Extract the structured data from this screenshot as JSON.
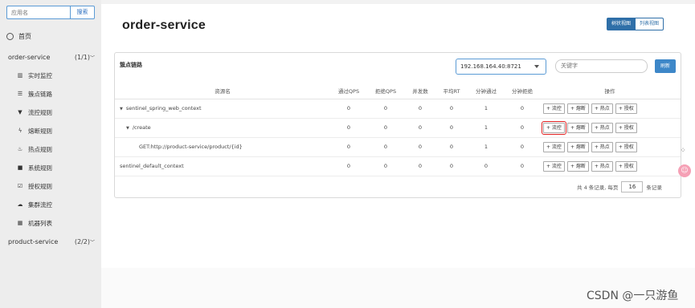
{
  "sidebar": {
    "search_placeholder": "应用名",
    "search_button": "搜索",
    "home": "首页",
    "apps": [
      {
        "name": "order-service",
        "count": "(1/1)",
        "items": [
          "实时监控",
          "簇点链路",
          "流控规则",
          "熔断规则",
          "热点规则",
          "系统规则",
          "授权规则",
          "集群流控",
          "机器列表"
        ]
      },
      {
        "name": "product-service",
        "count": "(2/2)"
      }
    ]
  },
  "main": {
    "title": "order-service",
    "view_tree": "树状视图",
    "view_list": "列表视图",
    "panel_title": "簇点链路",
    "machine": "192.168.164.40:8721",
    "keyword_placeholder": "关键字",
    "refresh": "刷新",
    "columns": [
      "资源名",
      "通过QPS",
      "拒绝QPS",
      "并发数",
      "平均RT",
      "分钟通过",
      "分钟拒绝",
      "操作"
    ],
    "rows": [
      {
        "name": "sentinel_spring_web_context",
        "level": 0,
        "toggle": "▼",
        "pass_qps": "0",
        "block_qps": "0",
        "concurrency": "0",
        "avg_rt": "0",
        "min_pass": "1",
        "min_block": "0"
      },
      {
        "name": "/create",
        "level": 1,
        "toggle": "▼",
        "pass_qps": "0",
        "block_qps": "0",
        "concurrency": "0",
        "avg_rt": "0",
        "min_pass": "1",
        "min_block": "0"
      },
      {
        "name": "GET:http://product-service/product/{id}",
        "level": 2,
        "toggle": "",
        "pass_qps": "0",
        "block_qps": "0",
        "concurrency": "0",
        "avg_rt": "0",
        "min_pass": "1",
        "min_block": "0"
      },
      {
        "name": "sentinel_default_context",
        "level": 0,
        "toggle": "",
        "pass_qps": "0",
        "block_qps": "0",
        "concurrency": "0",
        "avg_rt": "0",
        "min_pass": "0",
        "min_block": "0"
      }
    ],
    "actions": [
      "+ 流控",
      "+ 熔断",
      "+ 热点",
      "+ 授权"
    ],
    "pagination": {
      "summary": "共 4 条记录, 每页",
      "page_size": "16",
      "suffix": "条记录"
    }
  },
  "watermark": "CSDN @一只游鱼"
}
